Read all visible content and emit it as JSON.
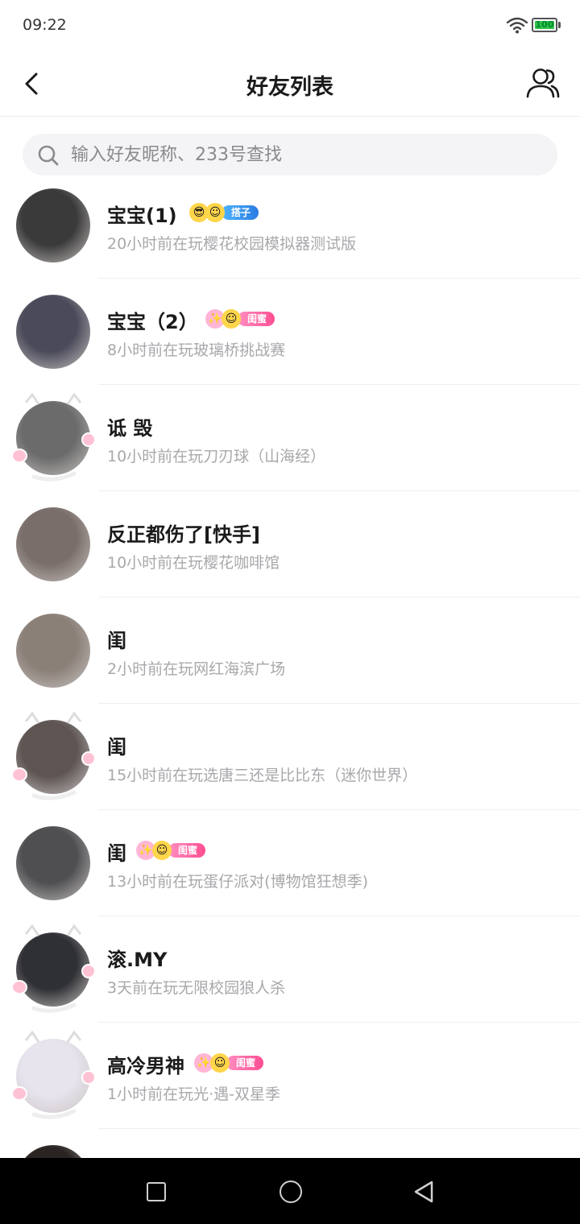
{
  "status_bar": {
    "time": "09:22",
    "battery": "100"
  },
  "header": {
    "title": "好友列表"
  },
  "search": {
    "placeholder": "输入好友昵称、233号查找",
    "value": ""
  },
  "friends": [
    {
      "name": "宝宝(1)",
      "status": "20小时前在玩樱花校园模拟器测试版",
      "badge": "搭子",
      "badge_type": "partner",
      "avatar_color": "#3a3a3a",
      "has_frame": false
    },
    {
      "name": "宝宝（2）",
      "status": "8小时前在玩玻璃桥挑战赛",
      "badge": "闺蜜",
      "badge_type": "bestie",
      "avatar_color": "#4a4a5a",
      "has_frame": false
    },
    {
      "name": "诋 毁",
      "status": "10小时前在玩刀刃球（山海经）",
      "badge": "",
      "badge_type": "",
      "avatar_color": "#6b6b6b",
      "has_frame": true
    },
    {
      "name": "反正都伤了[快手]",
      "status": "10小时前在玩樱花咖啡馆",
      "badge": "",
      "badge_type": "",
      "avatar_color": "#7a6e6a",
      "has_frame": false
    },
    {
      "name": "闺",
      "status": "2小时前在玩网红海滨广场",
      "badge": "",
      "badge_type": "",
      "avatar_color": "#8b8078",
      "has_frame": false
    },
    {
      "name": "闺",
      "status": "15小时前在玩选唐三还是比比东（迷你世界）",
      "badge": "",
      "badge_type": "",
      "avatar_color": "#5e5553",
      "has_frame": true
    },
    {
      "name": "闺",
      "status": "13小时前在玩蛋仔派对(博物馆狂想季)",
      "badge": "闺蜜",
      "badge_type": "bestie",
      "avatar_color": "#4f4f52",
      "has_frame": false
    },
    {
      "name": "滚.MY",
      "status": "3天前在玩无限校园狼人杀",
      "badge": "",
      "badge_type": "",
      "avatar_color": "#2f3035",
      "has_frame": true
    },
    {
      "name": "高冷男神",
      "status": "1小时前在玩光·遇-双星季",
      "badge": "闺蜜",
      "badge_type": "bestie",
      "avatar_color": "#e8e4ee",
      "has_frame": true
    },
    {
      "name": "",
      "status": "",
      "badge": "",
      "badge_type": "",
      "avatar_color": "#2a2522",
      "has_frame": false
    }
  ]
}
